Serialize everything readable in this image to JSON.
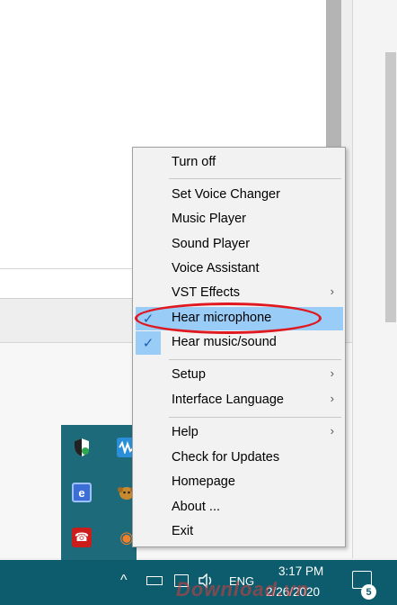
{
  "menu": {
    "items": [
      {
        "label": "Turn off"
      },
      {
        "label": "Set Voice Changer"
      },
      {
        "label": "Music Player"
      },
      {
        "label": "Sound Player"
      },
      {
        "label": "Voice Assistant"
      },
      {
        "label": "VST Effects",
        "submenu": true
      },
      {
        "label": "Hear microphone",
        "checked": true,
        "highlighted": true
      },
      {
        "label": "Hear music/sound",
        "checked": true
      },
      {
        "label": "Setup",
        "submenu": true
      },
      {
        "label": "Interface Language",
        "submenu": true
      },
      {
        "label": "Help",
        "submenu": true
      },
      {
        "label": "Check for Updates"
      },
      {
        "label": "Homepage"
      },
      {
        "label": "About ..."
      },
      {
        "label": "Exit"
      }
    ],
    "check_glyph": "✓",
    "submenu_glyph": "›"
  },
  "annotation": {
    "color": "#e0181f"
  },
  "tray_flyout": {
    "icons": [
      "shield-icon",
      "audio-wave-icon",
      "e-app-icon",
      "monkey-icon",
      "phone-icon",
      "swirl-icon"
    ],
    "glyphs": {
      "e": "e",
      "phone": "☎",
      "swirl": "◉"
    }
  },
  "taskbar": {
    "chevron": "^",
    "language": "ENG",
    "time": "3:17 PM",
    "date": "2/26/2020",
    "notification_count": "5",
    "accent": "#0d5c6d"
  },
  "watermark": {
    "text": "Download.vn"
  }
}
